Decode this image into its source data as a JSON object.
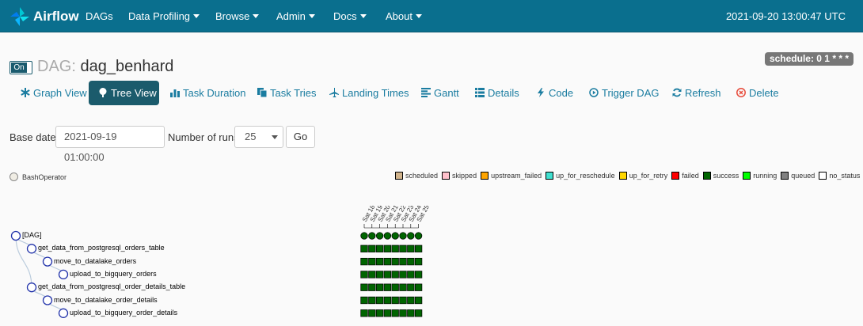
{
  "navbar": {
    "brand": "Airflow",
    "items": [
      {
        "label": "DAGs",
        "dropdown": false
      },
      {
        "label": "Data Profiling",
        "dropdown": true
      },
      {
        "label": "Browse",
        "dropdown": true
      },
      {
        "label": "Admin",
        "dropdown": true
      },
      {
        "label": "Docs",
        "dropdown": true
      },
      {
        "label": "About",
        "dropdown": true
      }
    ],
    "clock": "2021-09-20 13:00:47 UTC"
  },
  "dag": {
    "toggle_label": "On",
    "title_prefix": "DAG:",
    "dag_id": "dag_benhard",
    "schedule": "schedule: 0 1 * * *"
  },
  "toolbar": [
    {
      "label": "Graph View",
      "icon": "asterisk-icon",
      "active": false
    },
    {
      "label": "Tree View",
      "icon": "tree-icon",
      "active": true
    },
    {
      "label": "Task Duration",
      "icon": "bar-chart-icon",
      "active": false
    },
    {
      "label": "Task Tries",
      "icon": "duplicate-icon",
      "active": false
    },
    {
      "label": "Landing Times",
      "icon": "plane-icon",
      "active": false
    },
    {
      "label": "Gantt",
      "icon": "align-left-icon",
      "active": false
    },
    {
      "label": "Details",
      "icon": "list-icon",
      "active": false
    },
    {
      "label": "Code",
      "icon": "flash-icon",
      "active": false
    },
    {
      "label": "Trigger DAG",
      "icon": "play-circle-icon",
      "active": false
    },
    {
      "label": "Refresh",
      "icon": "refresh-icon",
      "active": false
    },
    {
      "label": "Delete",
      "icon": "remove-circle-icon",
      "active": false
    }
  ],
  "form": {
    "base_date_label": "Base date:",
    "base_date_value": "2021-09-19 01:00:00",
    "runs_label": "Number of runs:",
    "runs_value": "25",
    "go_label": "Go"
  },
  "operator_legend": {
    "label": "BashOperator",
    "color": "#f0ede4"
  },
  "state_legend": [
    {
      "label": "scheduled",
      "color": "#d2b48c"
    },
    {
      "label": "skipped",
      "color": "#ffc0cb"
    },
    {
      "label": "upstream_failed",
      "color": "#ffa500"
    },
    {
      "label": "up_for_reschedule",
      "color": "#40e0d0"
    },
    {
      "label": "up_for_retry",
      "color": "#ffd700"
    },
    {
      "label": "failed",
      "color": "#ff0000"
    },
    {
      "label": "success",
      "color": "#006400"
    },
    {
      "label": "running",
      "color": "#00ff00"
    },
    {
      "label": "queued",
      "color": "#808080"
    },
    {
      "label": "no_status",
      "color": "#ffffff"
    }
  ],
  "tree": {
    "date_labels": [
      "Sat 18",
      "Sat 19",
      "Sat 20",
      "Sat 21",
      "Sat 22",
      "Sat 23",
      "Sat 24",
      "Sat 25"
    ],
    "nodes": [
      {
        "label": "[DAG]",
        "depth": 0
      },
      {
        "label": "get_data_from_postgresql_orders_table",
        "depth": 1
      },
      {
        "label": "move_to_datalake_orders",
        "depth": 2
      },
      {
        "label": "upload_to_bigquery_orders",
        "depth": 3
      },
      {
        "label": "get_data_from_postgresql_order_details_table",
        "depth": 1
      },
      {
        "label": "move_to_datalake_order_details",
        "depth": 2
      },
      {
        "label": "upload_to_bigquery_order_details",
        "depth": 3
      }
    ],
    "run_state": "success",
    "task_state": "success",
    "success_color": "#006400"
  }
}
